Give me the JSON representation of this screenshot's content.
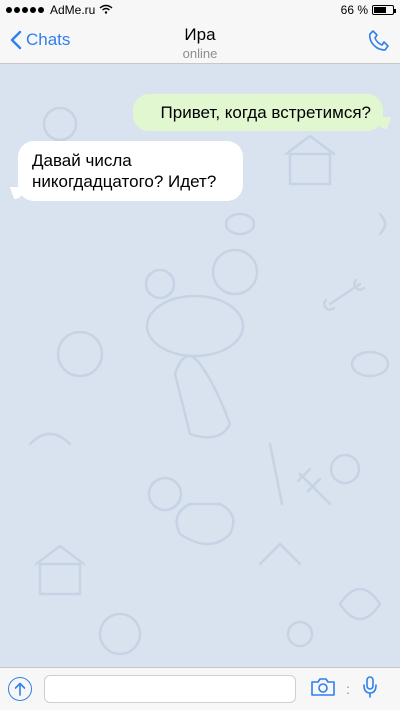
{
  "status_bar": {
    "carrier": "AdMe.ru",
    "battery": "66 %",
    "battery_level": 0.66
  },
  "header": {
    "back_label": "Chats",
    "contact_name": "Ира",
    "contact_status": "online"
  },
  "messages": [
    {
      "direction": "outgoing",
      "text": "Привет, когда встретимся?"
    },
    {
      "direction": "incoming",
      "text": "Давай числа никогдадцатого? Идет?"
    }
  ],
  "colors": {
    "accent": "#2f80ed",
    "chat_background": "#d9e3f0",
    "outgoing_bubble": "#e1f7cf",
    "incoming_bubble": "#ffffff"
  },
  "icons": {
    "back": "chevron-left-icon",
    "call": "phone-icon",
    "attach": "upload-icon",
    "camera": "camera-icon",
    "mic": "microphone-icon"
  }
}
